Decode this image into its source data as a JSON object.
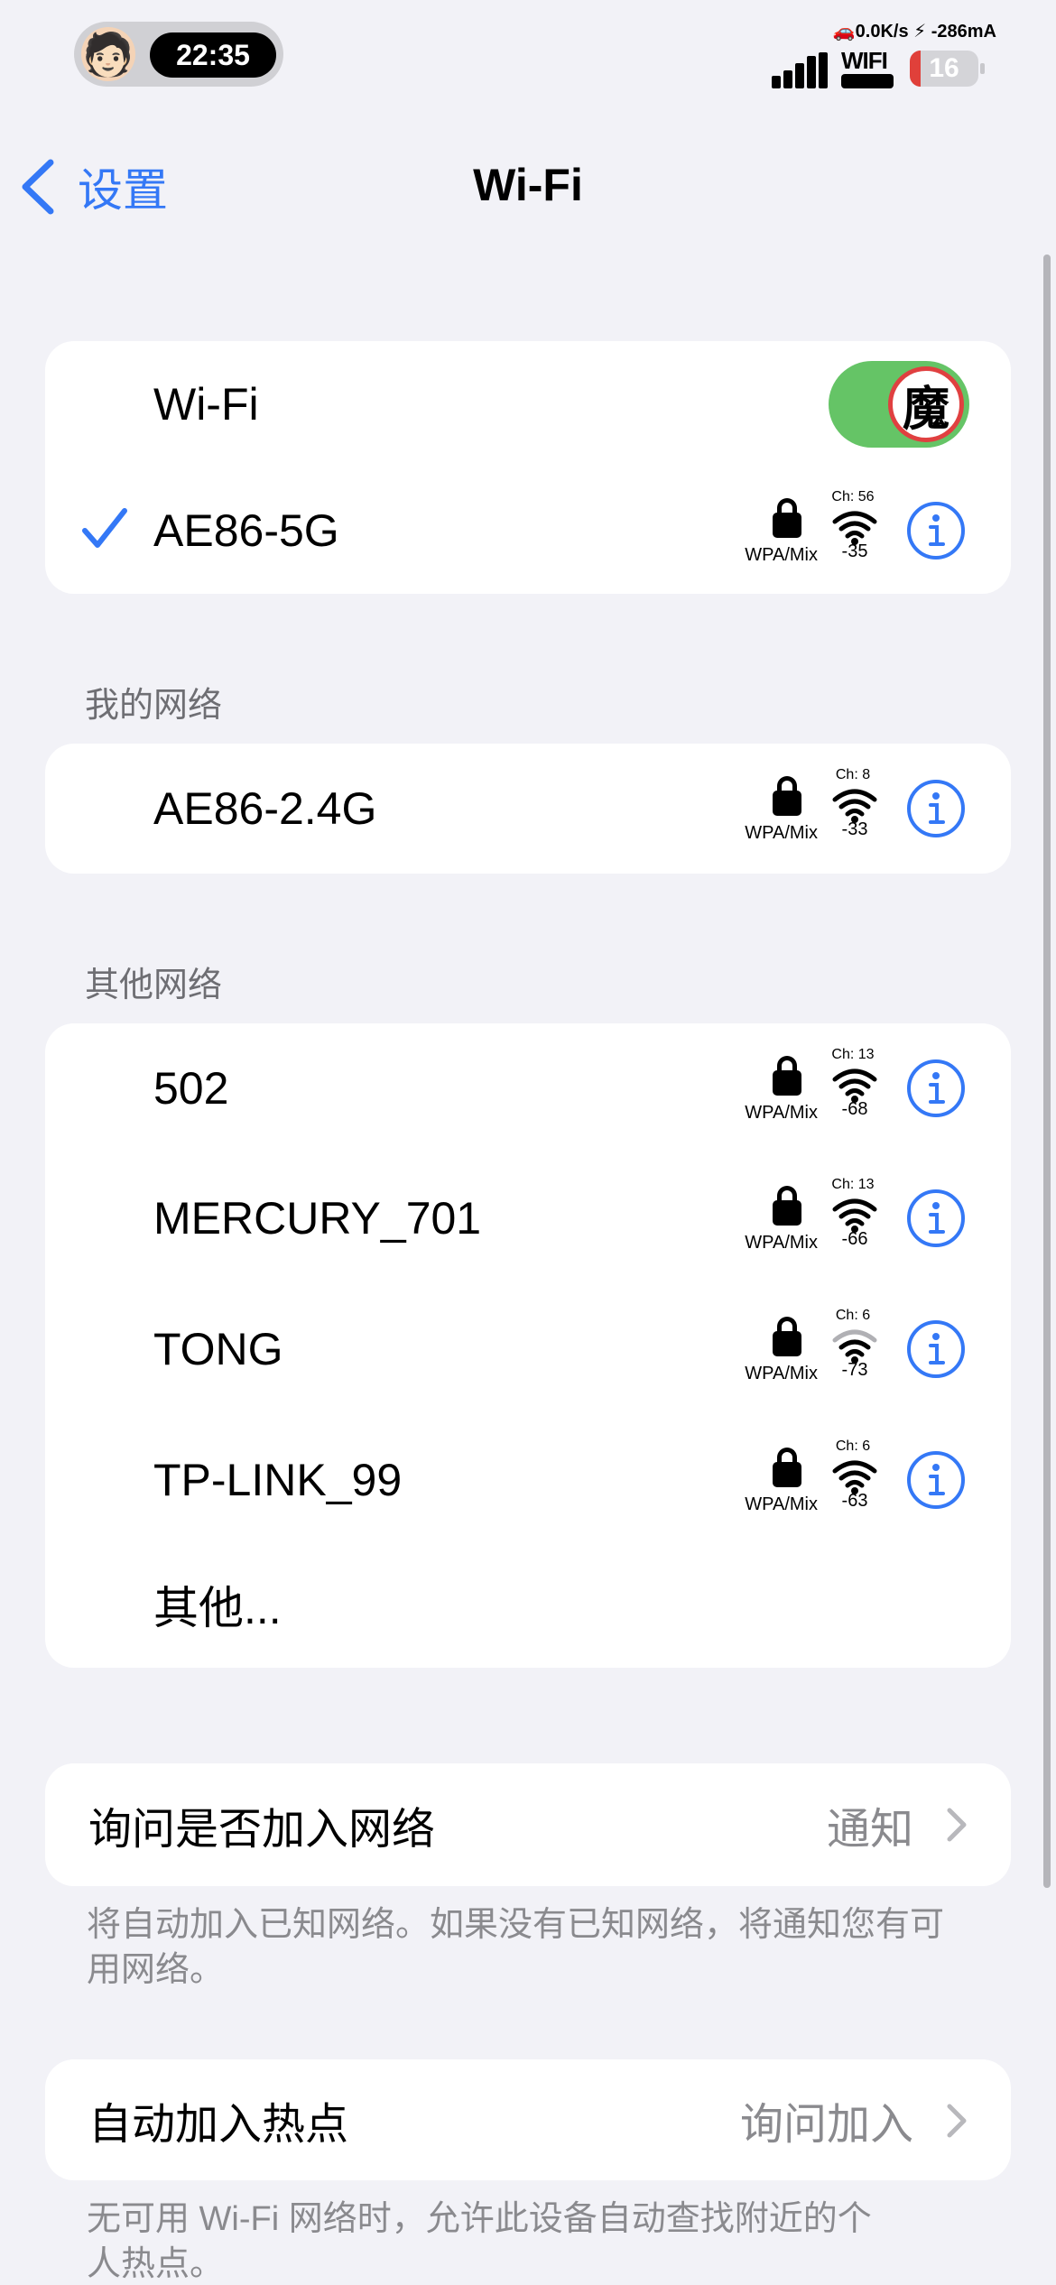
{
  "status_bar": {
    "time": "22:35",
    "avatar": "🧑🏻",
    "net_speed": "🚗0.0K/s ⚡ -286mA",
    "wifi_label": "WIFI",
    "battery_level": "16",
    "battery_fraction": 0.16
  },
  "nav": {
    "back_label": "设置",
    "title": "Wi-Fi"
  },
  "wifi_toggle": {
    "label": "Wi-Fi",
    "on": true,
    "knob_glyph": "魔"
  },
  "connected": {
    "ssid": "AE86-5G",
    "security": "WPA/Mix",
    "channel": "Ch: 56",
    "rssi": "-35"
  },
  "my_networks": {
    "header": "我的网络",
    "items": [
      {
        "ssid": "AE86-2.4G",
        "security": "WPA/Mix",
        "channel": "Ch: 8",
        "rssi": "-33"
      }
    ]
  },
  "other_networks": {
    "header": "其他网络",
    "items": [
      {
        "ssid": "502",
        "security": "WPA/Mix",
        "channel": "Ch: 13",
        "rssi": "-68",
        "strength": 3
      },
      {
        "ssid": "MERCURY_701",
        "security": "WPA/Mix",
        "channel": "Ch: 13",
        "rssi": "-66",
        "strength": 3
      },
      {
        "ssid": "TONG",
        "security": "WPA/Mix",
        "channel": "Ch: 6",
        "rssi": "-73",
        "strength": 2
      },
      {
        "ssid": "TP-LINK_99",
        "security": "WPA/Mix",
        "channel": "Ch: 6",
        "rssi": "-63",
        "strength": 3
      }
    ],
    "other_label": "其他..."
  },
  "ask_to_join": {
    "label": "询问是否加入网络",
    "value": "通知",
    "footnote": "将自动加入已知网络。如果没有已知网络，将通知您有可用网络。"
  },
  "auto_hotspot": {
    "label": "自动加入热点",
    "value": "询问加入",
    "footnote": "无可用 Wi-Fi 网络时，允许此设备自动查找附近的个人热点。"
  },
  "colors": {
    "accent": "#3478f6",
    "toggle_on": "#65c466",
    "background": "#f2f2f7",
    "battery_low": "#e0403a"
  },
  "icons": {
    "back": "chevron-left-icon",
    "check": "checkmark-icon",
    "lock": "lock-icon",
    "wifi": "wifi-signal-icon",
    "info": "info-circle-icon",
    "disclosure": "chevron-right-icon"
  }
}
